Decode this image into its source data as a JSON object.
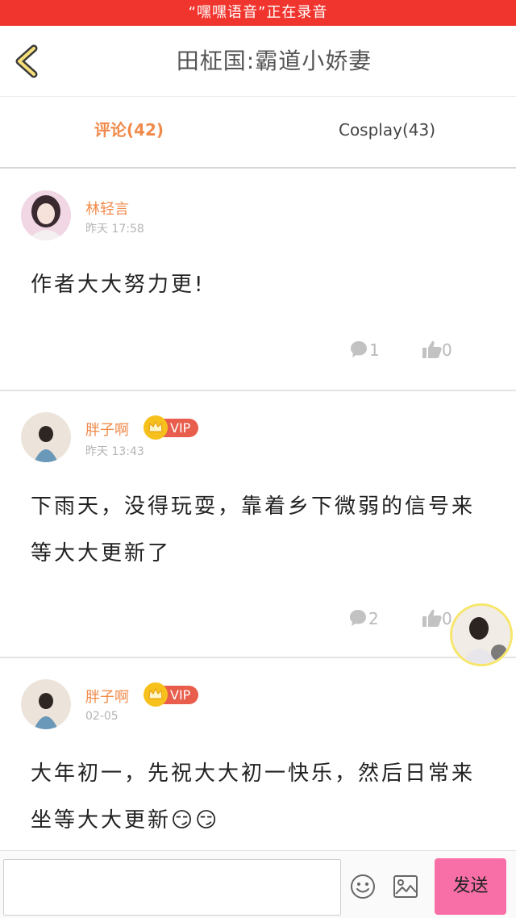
{
  "status_bar": {
    "recording_text": "“嘿嘿语音”正在录音"
  },
  "header": {
    "title": "田柾国:霸道小娇妻"
  },
  "tabs": [
    {
      "label": "评论(42)",
      "active": true
    },
    {
      "label": "Cosplay(43)",
      "active": false
    }
  ],
  "comments": [
    {
      "username": "林轻言",
      "time": "昨天  17:58",
      "vip": false,
      "content": "作者大大努力更!",
      "reply_count": "1",
      "like_count": "0"
    },
    {
      "username": "胖子啊",
      "time": "昨天  13:43",
      "vip": true,
      "vip_label": "VIP",
      "content": "下雨天，没得玩耍，靠着乡下微弱的信号来等大大更新了",
      "reply_count": "2",
      "like_count": "0"
    },
    {
      "username": "胖子啊",
      "time": "02-05",
      "vip": true,
      "vip_label": "VIP",
      "content": "大年初一，先祝大大初一快乐，然后日常来坐等大大更新😏😏"
    }
  ],
  "composer": {
    "input_value": "",
    "send_label": "发送"
  },
  "colors": {
    "accent": "#f08a4b",
    "recording_bar": "#f0352e",
    "send_button": "#f86fa8",
    "vip_badge": "#e85d4c"
  }
}
